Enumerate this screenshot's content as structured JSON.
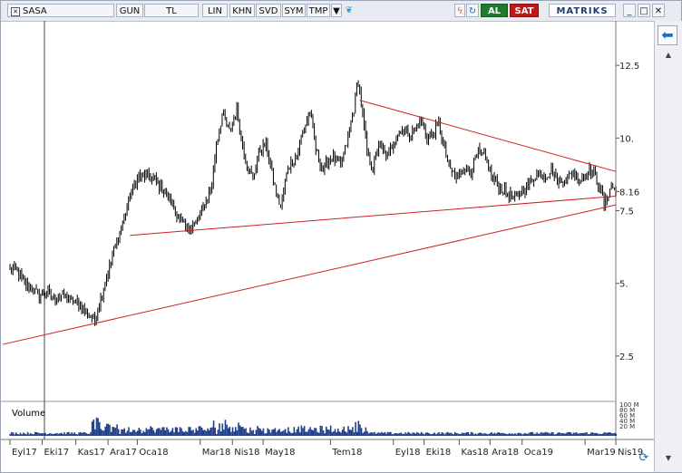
{
  "toolbar": {
    "symbol": "SASA",
    "period": "GUN",
    "currency": "TL",
    "scale": "LIN",
    "buttons": [
      "KHN",
      "SVD",
      "SYM",
      "TMP"
    ],
    "dropdown_icon": "triangle-down-icon",
    "twitter_icon": "twitter-bird-icon",
    "lightning_icon": "lightning-icon",
    "refresh_icon": "refresh-icon",
    "buy": "AL",
    "sell": "SAT",
    "brand": "MATRIKS",
    "win_minimize": "_",
    "win_maximize": "□",
    "win_close": "✕"
  },
  "side": {
    "arrow_icon": "left-arrow-icon"
  },
  "colors": {
    "price": "#000000",
    "trend": "#cc2020",
    "volume": "#1f3f8a",
    "buy": "#1f7a2e",
    "sell": "#c01818"
  },
  "chart_data": {
    "type": "line",
    "symbol": "SASA",
    "y_ticks": [
      "12.5",
      "10.",
      "7.5",
      "5.",
      "2.5"
    ],
    "y_tick_values": [
      12.5,
      10,
      7.5,
      5,
      2.5
    ],
    "ylim": [
      1.0,
      14.0
    ],
    "last_price_label": "8.16",
    "last_price": 8.16,
    "x_labels": [
      "Eyl17",
      "Eki17",
      "Kas17",
      "Ara17",
      "Oca18",
      "Mar18",
      "Nis18",
      "May18",
      "Tem18",
      "Eyl18",
      "Eki18",
      "Kas18",
      "Ara18",
      "Oca19",
      "Mar19",
      "Nis19"
    ],
    "x_label_index": [
      0,
      22,
      45,
      67,
      87,
      130,
      152,
      173,
      219,
      262,
      283,
      307,
      328,
      350,
      393,
      414
    ],
    "price_keypoints": [
      [
        0,
        5.5
      ],
      [
        5,
        5.4
      ],
      [
        10,
        5.0
      ],
      [
        15,
        4.8
      ],
      [
        20,
        4.6
      ],
      [
        25,
        4.7
      ],
      [
        30,
        4.5
      ],
      [
        35,
        4.6
      ],
      [
        40,
        4.5
      ],
      [
        48,
        4.2
      ],
      [
        55,
        3.9
      ],
      [
        58,
        3.7
      ],
      [
        62,
        4.5
      ],
      [
        66,
        5.2
      ],
      [
        72,
        6.3
      ],
      [
        76,
        6.9
      ],
      [
        82,
        8.0
      ],
      [
        88,
        8.7
      ],
      [
        94,
        8.7
      ],
      [
        100,
        8.5
      ],
      [
        105,
        8.2
      ],
      [
        110,
        7.8
      ],
      [
        116,
        7.2
      ],
      [
        120,
        6.9
      ],
      [
        126,
        7.0
      ],
      [
        131,
        7.5
      ],
      [
        135,
        8.0
      ],
      [
        138,
        8.4
      ],
      [
        141,
        9.8
      ],
      [
        145,
        10.8
      ],
      [
        150,
        10.2
      ],
      [
        155,
        11.0
      ],
      [
        158,
        10.0
      ],
      [
        162,
        9.0
      ],
      [
        166,
        8.6
      ],
      [
        170,
        9.5
      ],
      [
        175,
        9.8
      ],
      [
        181,
        8.3
      ],
      [
        185,
        7.6
      ],
      [
        190,
        9.0
      ],
      [
        196,
        9.4
      ],
      [
        200,
        10.2
      ],
      [
        205,
        10.9
      ],
      [
        209,
        9.6
      ],
      [
        214,
        8.9
      ],
      [
        220,
        9.4
      ],
      [
        226,
        9.0
      ],
      [
        230,
        9.8
      ],
      [
        235,
        11.0
      ],
      [
        238,
        12.0
      ],
      [
        240,
        11.2
      ],
      [
        244,
        9.5
      ],
      [
        248,
        9.0
      ],
      [
        252,
        9.8
      ],
      [
        258,
        9.3
      ],
      [
        263,
        10.0
      ],
      [
        268,
        10.3
      ],
      [
        274,
        10.1
      ],
      [
        278,
        10.4
      ],
      [
        281,
        10.6
      ],
      [
        285,
        10.0
      ],
      [
        290,
        10.2
      ],
      [
        293,
        10.5
      ],
      [
        296,
        9.8
      ],
      [
        300,
        9.0
      ],
      [
        305,
        8.6
      ],
      [
        310,
        9.0
      ],
      [
        315,
        8.8
      ],
      [
        320,
        9.5
      ],
      [
        325,
        9.3
      ],
      [
        330,
        8.6
      ],
      [
        335,
        8.3
      ],
      [
        340,
        8.1
      ],
      [
        345,
        7.9
      ],
      [
        350,
        8.2
      ],
      [
        356,
        8.5
      ],
      [
        360,
        8.8
      ],
      [
        366,
        8.7
      ],
      [
        370,
        8.9
      ],
      [
        375,
        8.5
      ],
      [
        380,
        8.6
      ],
      [
        385,
        8.8
      ],
      [
        390,
        8.6
      ],
      [
        395,
        8.9
      ],
      [
        400,
        8.7
      ],
      [
        404,
        8.2
      ],
      [
        406,
        7.7
      ],
      [
        408,
        7.9
      ],
      [
        410,
        8.3
      ],
      [
        412,
        8.3
      ],
      [
        414,
        8.16
      ]
    ],
    "trendlines": [
      {
        "from": [
          -5,
          2.9
        ],
        "to": [
          414,
          7.7
        ]
      },
      {
        "from": [
          82,
          6.65
        ],
        "to": [
          414,
          8.0
        ]
      },
      {
        "from": [
          239,
          11.3
        ],
        "to": [
          414,
          8.85
        ]
      }
    ],
    "volume_label": "Volume",
    "volume_ticks": [
      "100 M",
      "80 M",
      "60 M",
      "40 M",
      "20 M"
    ],
    "volume_ylim": [
      0,
      110
    ]
  }
}
